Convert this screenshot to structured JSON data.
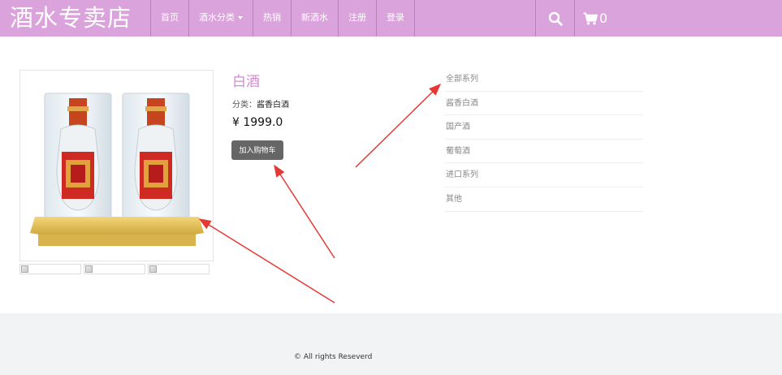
{
  "header": {
    "brand": "酒水专卖店",
    "nav": [
      {
        "label": "首页"
      },
      {
        "label": "酒水分类",
        "has_caret": true
      },
      {
        "label": "热销"
      },
      {
        "label": "新酒水"
      },
      {
        "label": "注册"
      },
      {
        "label": "登录"
      }
    ],
    "cart_count": "0",
    "icons": [
      "search-icon",
      "cart-icon"
    ]
  },
  "product": {
    "title": "白酒",
    "category_label": "分类：",
    "category_value": "酱香白酒",
    "price": "¥ 1999.0",
    "add_to_cart": "加入购物车",
    "thumbnail_count": 3
  },
  "sidebar": {
    "categories": [
      "全部系列",
      "酱香白酒",
      "国产酒",
      "葡萄酒",
      "进口系列",
      "其他"
    ]
  },
  "footer": {
    "copyright": "© All rights Reseverd"
  },
  "colors": {
    "header_bg": "#dba3dc",
    "title": "#d18bd2",
    "button": "#666666",
    "arrow": "#e53935",
    "footer_bg": "#f2f3f5"
  }
}
